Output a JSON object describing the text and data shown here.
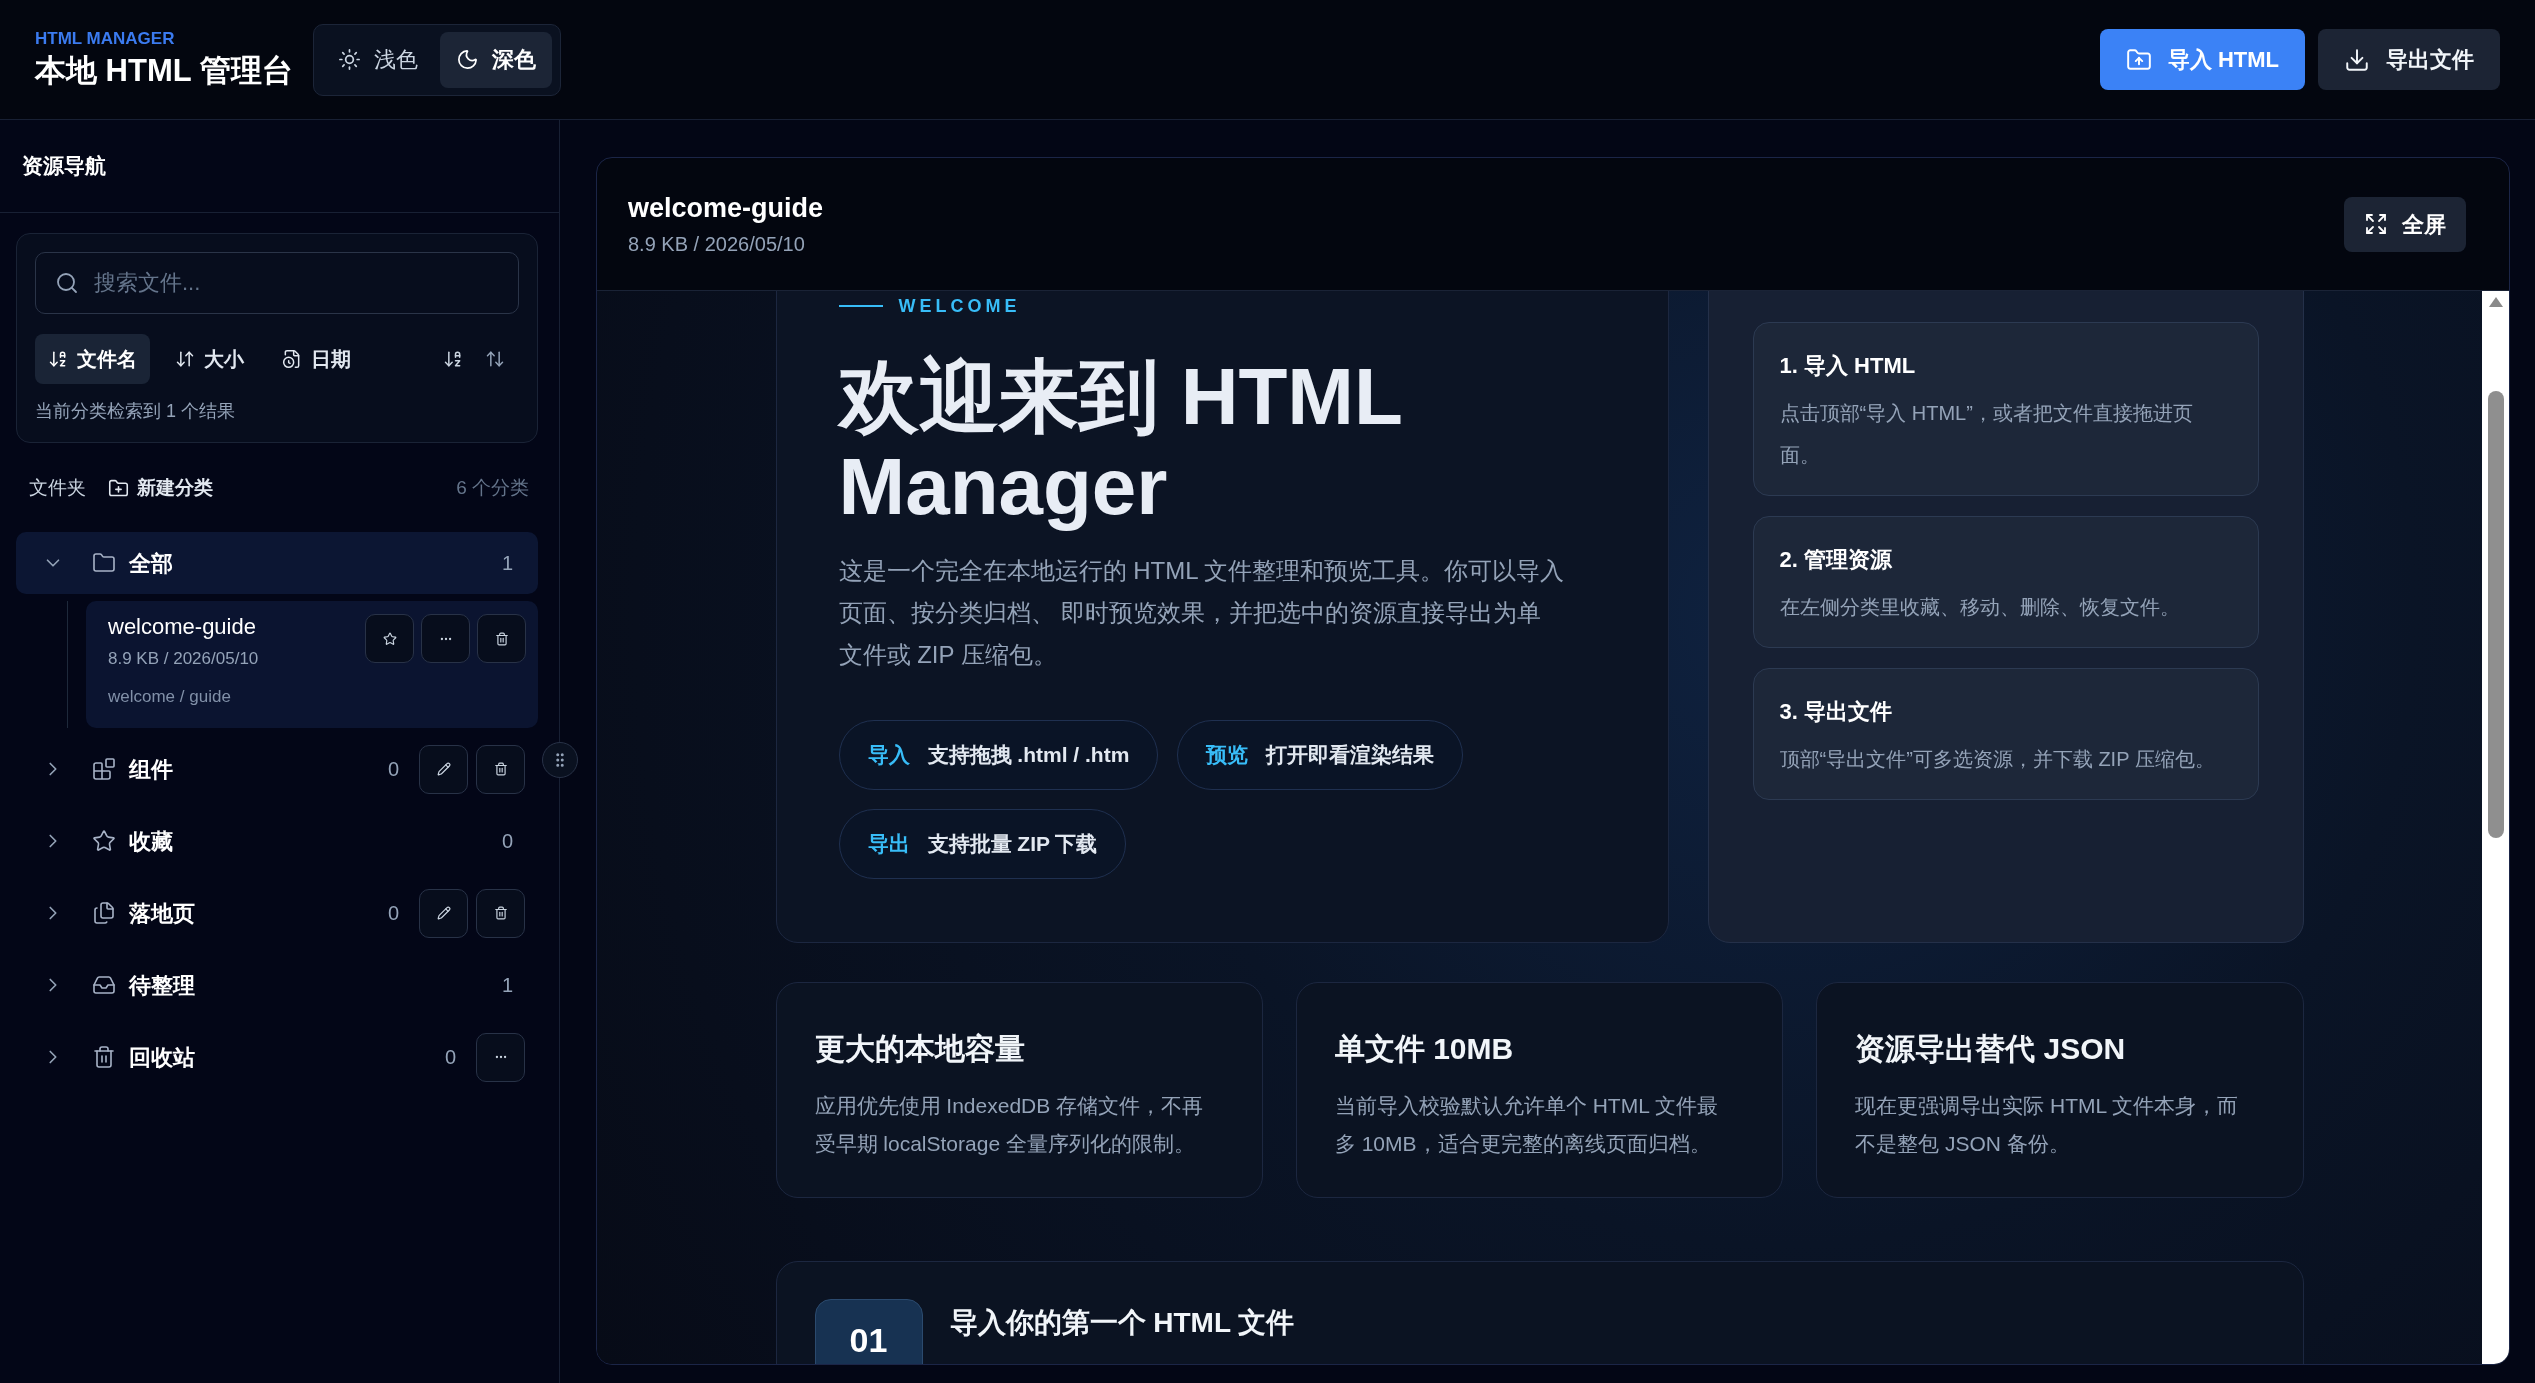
{
  "header": {
    "eyebrow": "HTML MANAGER",
    "title": "本地 HTML 管理台",
    "theme_toggle": [
      {
        "kind": "light",
        "label": "浅色",
        "selected": false
      },
      {
        "kind": "dark",
        "label": "深色",
        "selected": true
      }
    ],
    "actions": [
      {
        "kind": "import",
        "label": "导入 HTML"
      },
      {
        "kind": "export",
        "label": "导出文件"
      }
    ]
  },
  "sidebar": {
    "title": "资源导航",
    "search": {
      "placeholder": "搜索文件..."
    },
    "sort_options": [
      {
        "kind": "name",
        "label": "文件名",
        "selected": true
      },
      {
        "kind": "size",
        "label": "大小",
        "selected": false
      },
      {
        "kind": "date",
        "label": "日期",
        "selected": false
      }
    ],
    "result_text": "当前分类检索到 1 个结果",
    "folders_label": "文件夹",
    "new_category": "新建分类",
    "category_count": "6 个分类",
    "tree": [
      {
        "kind": "folder",
        "label": "全部",
        "count": "1",
        "selected": true,
        "expanded": true,
        "children": [
          {
            "name": "welcome-guide",
            "meta": "8.9 KB / 2026/05/10",
            "path": "welcome / guide",
            "selected": true,
            "actions": [
              {
                "kind": "favorite"
              },
              {
                "kind": "more"
              },
              {
                "kind": "delete"
              }
            ]
          }
        ]
      },
      {
        "kind": "blocks",
        "label": "组件",
        "count": "0",
        "selected": false,
        "expanded": false,
        "actions": [
          {
            "kind": "edit"
          },
          {
            "kind": "delete"
          }
        ]
      },
      {
        "kind": "star",
        "label": "收藏",
        "count": "0",
        "selected": false,
        "expanded": false
      },
      {
        "kind": "files",
        "label": "落地页",
        "count": "0",
        "selected": false,
        "expanded": false,
        "actions": [
          {
            "kind": "edit"
          },
          {
            "kind": "delete"
          }
        ]
      },
      {
        "kind": "inbox",
        "label": "待整理",
        "count": "1",
        "selected": false,
        "expanded": false
      },
      {
        "kind": "trash",
        "label": "回收站",
        "count": "0",
        "selected": false,
        "expanded": false,
        "actions": [
          {
            "kind": "more"
          }
        ]
      }
    ]
  },
  "preview": {
    "title": "welcome-guide",
    "meta": "8.9 KB / 2026/05/10",
    "fullscreen_label": "全屏",
    "page": {
      "eyebrow": "WELCOME",
      "title": "欢迎来到 HTML Manager",
      "intro": "这是一个完全在本地运行的 HTML 文件整理和预览工具。你可以导入页面、按分类归档、 即时预览效果，并把选中的资源直接导出为单文件或 ZIP 压缩包。",
      "pills": [
        {
          "tag": "导入",
          "text": "支持拖拽 .html / .htm"
        },
        {
          "tag": "预览",
          "text": "打开即看渲染结果"
        },
        {
          "tag": "导出",
          "text": "支持批量 ZIP 下载"
        }
      ],
      "steps": [
        {
          "title": "1. 导入 HTML",
          "text": "点击顶部“导入 HTML”，或者把文件直接拖进页面。"
        },
        {
          "title": "2. 管理资源",
          "text": "在左侧分类里收藏、移动、删除、恢复文件。"
        },
        {
          "title": "3. 导出文件",
          "text": "顶部“导出文件”可多选资源，并下载 ZIP 压缩包。"
        }
      ],
      "features": [
        {
          "title": "更大的本地容量",
          "text": "应用优先使用 IndexedDB 存储文件，不再受早期 localStorage 全量序列化的限制。"
        },
        {
          "title": "单文件 10MB",
          "text": "当前导入校验默认允许单个 HTML 文件最多 10MB，适合更完整的离线页面归档。"
        },
        {
          "title": "资源导出替代 JSON",
          "text": "现在更强调导出实际 HTML 文件本身，而不是整包 JSON 备份。"
        }
      ],
      "next_section": {
        "number": "01",
        "title": "导入你的第一个 HTML 文件"
      }
    }
  }
}
